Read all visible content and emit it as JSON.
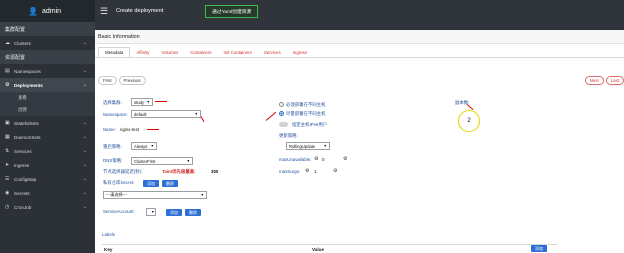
{
  "brand": {
    "title": "admin"
  },
  "sidebar": {
    "sections": [
      {
        "label": "集群配置"
      },
      {
        "label": "资源配置"
      }
    ],
    "items": [
      {
        "label": "Clusters",
        "icon": "cloud-icon"
      },
      {
        "label": "Namespaces",
        "icon": "folder-icon"
      },
      {
        "label": "Deployments",
        "icon": "gear-icon"
      },
      {
        "label": "StatefulSets",
        "icon": "stateful-icon"
      },
      {
        "label": "DaemonSets",
        "icon": "daemon-icon"
      },
      {
        "label": "Services",
        "icon": "service-icon"
      },
      {
        "label": "Ingress",
        "icon": "ingress-icon"
      },
      {
        "label": "ConfigMap",
        "icon": "config-icon"
      },
      {
        "label": "Secrets",
        "icon": "lock-icon"
      },
      {
        "label": "CronJob",
        "icon": "clock-icon"
      }
    ],
    "sub_items": [
      {
        "label": "查看"
      },
      {
        "label": "创建"
      }
    ]
  },
  "topbar": {
    "title": "Create deployment",
    "yaml_button": "通过Yaml创建资源"
  },
  "panel": {
    "heading": "Basic Information",
    "tabs": [
      "Metadata",
      "Affinity",
      "Volumes",
      "Containers",
      "Init Containers",
      "Services",
      "Ingress"
    ],
    "first": "First",
    "previous": "Previous",
    "next": "Next",
    "last": "Last"
  },
  "form": {
    "cluster_label": "选择集群:",
    "cluster_value": "study",
    "namespace_label": "Namespace:",
    "namespace_value": "default",
    "name_label": "Name:",
    "name_value": "nginx-test",
    "restart_label": "重启策略:",
    "restart_value": "Always",
    "dns_label": "DNS策略:",
    "dns_value": "ClusterFirst",
    "grace_label": "节点选择器延迟(秒):",
    "grace_hint": "Taint优先级最高:",
    "grace_value": "300",
    "secret_label": "私有仓库Secret:",
    "add": "添加",
    "delete": "删除",
    "secret_select": "---请选择---",
    "sa_label": "ServiceAccount:",
    "radio1": "必须部署在不同主机",
    "radio2": "尽量部署在不同主机",
    "toggle_label": "指定主机IPv6用户",
    "strategy_label": "更新策略:",
    "strategy_value": "RollingUpdate",
    "max_unavailable_label": "maxUnavailable:",
    "max_unavailable_value": "0",
    "max_surge_label": "maxSurge:",
    "max_surge_value": "1",
    "replicas_label": "副本数:",
    "replicas_value": "2",
    "labels_title": "Labels",
    "labels_add": "添加",
    "key_col": "Key",
    "value_col": "Value"
  },
  "colors": {
    "accent": "#2e6fd6",
    "danger": "#d0312d",
    "sidebar": "#2b3137",
    "highlight": "#e8d400"
  }
}
